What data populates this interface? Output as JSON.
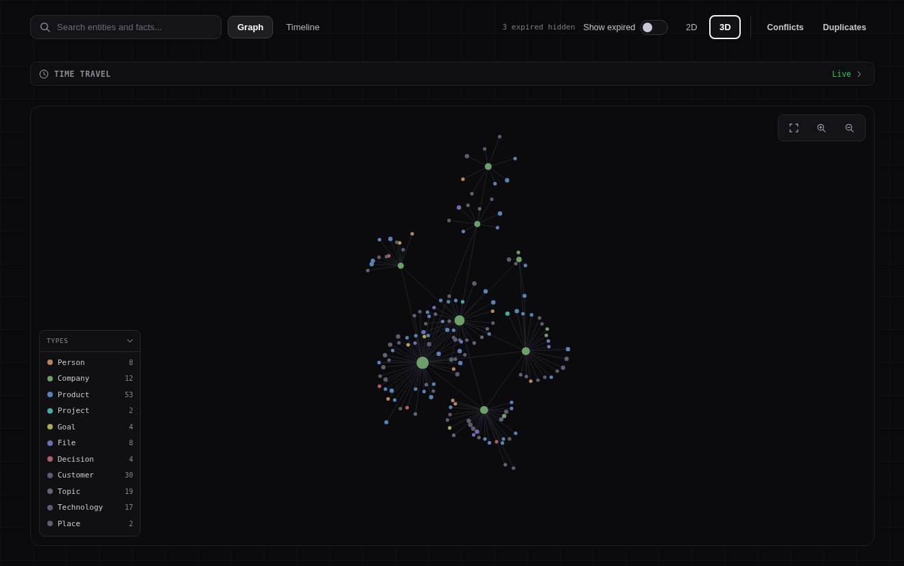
{
  "search": {
    "placeholder": "Search entities and facts..."
  },
  "view_tabs": [
    {
      "label": "Graph",
      "selected": true
    },
    {
      "label": "Timeline",
      "selected": false
    }
  ],
  "expired_note": "3 expired hidden",
  "show_expired": {
    "label": "Show expired",
    "on": false
  },
  "dimension_tabs": [
    {
      "label": "2D",
      "selected": false
    },
    {
      "label": "3D",
      "selected": true
    }
  ],
  "actions": [
    "Conflicts",
    "Duplicates"
  ],
  "time_travel": {
    "title": "TIME TRAVEL",
    "status": "Live"
  },
  "types": {
    "title": "TYPES",
    "expanded": true,
    "items": [
      {
        "label": "Person",
        "count": "8",
        "color": "#b78560"
      },
      {
        "label": "Company",
        "count": "12",
        "color": "#6d9e6b"
      },
      {
        "label": "Product",
        "count": "53",
        "color": "#5b82b5"
      },
      {
        "label": "Project",
        "count": "2",
        "color": "#4fa8a3"
      },
      {
        "label": "Goal",
        "count": "4",
        "color": "#b3a85a"
      },
      {
        "label": "File",
        "count": "8",
        "color": "#6e6fb5"
      },
      {
        "label": "Decision",
        "count": "4",
        "color": "#b35c6e"
      },
      {
        "label": "Customer",
        "count": "30",
        "color": "#5c5c6e"
      },
      {
        "label": "Topic",
        "count": "19",
        "color": "#636378"
      },
      {
        "label": "Technology",
        "count": "17",
        "color": "#5e5e70"
      },
      {
        "label": "Place",
        "count": "2",
        "color": "#5e5e70"
      }
    ]
  }
}
